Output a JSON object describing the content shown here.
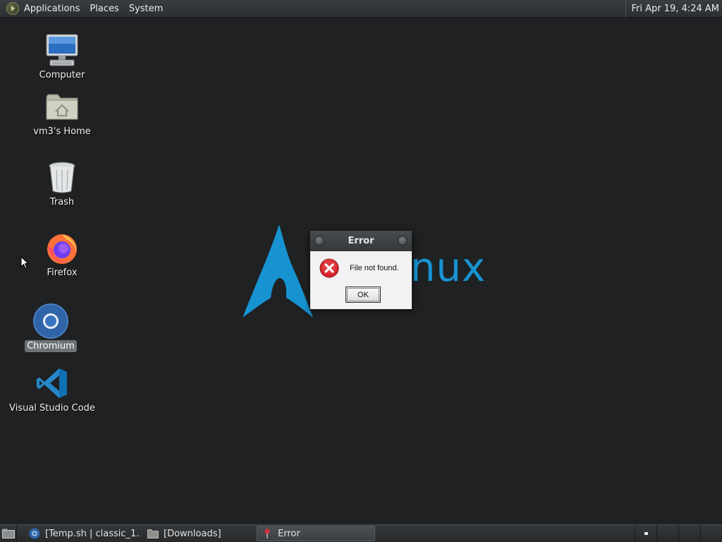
{
  "top_panel": {
    "menus": [
      "Applications",
      "Places",
      "System"
    ],
    "clock": "Fri Apr 19,  4:24 AM"
  },
  "desktop_icons": [
    {
      "label": "Computer",
      "icon": "computer-icon"
    },
    {
      "label": "vm3's Home",
      "icon": "home-folder-icon"
    },
    {
      "label": "Trash",
      "icon": "trash-icon"
    },
    {
      "label": "Firefox",
      "icon": "firefox-icon"
    },
    {
      "label": "Chromium",
      "icon": "chromium-icon",
      "selected": true
    },
    {
      "label": "Visual Studio Code",
      "icon": "vscode-icon"
    }
  ],
  "wallpaper": {
    "text_visible": "nux",
    "tm": "™",
    "accent": "#1793d1"
  },
  "error_dialog": {
    "title": "Error",
    "message": "File not found.",
    "ok_label": "OK",
    "icon": "error-icon"
  },
  "taskbar": {
    "tasks": [
      {
        "label": "[Temp.sh | classic_1....",
        "icon": "chromium-icon",
        "active": false
      },
      {
        "label": "[Downloads]",
        "icon": "folder-icon",
        "active": false
      },
      {
        "label": "Error",
        "icon": "error-app-icon",
        "active": true
      }
    ],
    "workspace_count": 4
  }
}
